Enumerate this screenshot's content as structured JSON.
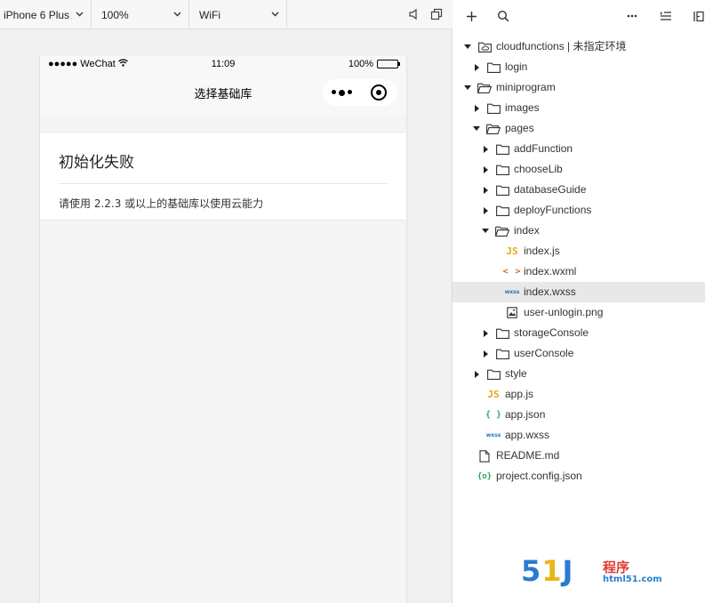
{
  "simulator": {
    "device": "iPhone 6 Plus",
    "zoom": "100%",
    "network": "WiFi"
  },
  "phone": {
    "status": {
      "carrier": "●●●●● WeChat",
      "time": "11:09",
      "battery": "100%",
      "battery_level": 1.0
    },
    "nav_title": "选择基础库",
    "error_title": "初始化失败",
    "error_message": "请使用 2.2.3 或以上的基础库以使用云能力"
  },
  "explorer": {
    "tree": [
      {
        "label": "cloudfunctions | 未指定环境",
        "icon": "cloud-folder-icon",
        "depth": 0,
        "expanded": true
      },
      {
        "label": "login",
        "icon": "folder-icon",
        "depth": 1,
        "expanded": false
      },
      {
        "label": "miniprogram",
        "icon": "folder-open-icon",
        "depth": 0,
        "expanded": true
      },
      {
        "label": "images",
        "icon": "folder-icon",
        "depth": 1,
        "expanded": false
      },
      {
        "label": "pages",
        "icon": "folder-open-icon",
        "depth": 1,
        "expanded": true
      },
      {
        "label": "addFunction",
        "icon": "folder-icon",
        "depth": 2,
        "expanded": false
      },
      {
        "label": "chooseLib",
        "icon": "folder-icon",
        "depth": 2,
        "expanded": false
      },
      {
        "label": "databaseGuide",
        "icon": "folder-icon",
        "depth": 2,
        "expanded": false
      },
      {
        "label": "deployFunctions",
        "icon": "folder-icon",
        "depth": 2,
        "expanded": false
      },
      {
        "label": "index",
        "icon": "folder-open-icon",
        "depth": 2,
        "expanded": true
      },
      {
        "label": "index.js",
        "icon": "js-file-icon",
        "depth": 3,
        "badge": "JS"
      },
      {
        "label": "index.wxml",
        "icon": "wxml-file-icon",
        "depth": 3,
        "badge": "< >"
      },
      {
        "label": "index.wxss",
        "icon": "wxss-file-icon",
        "depth": 3,
        "badge": "wxss",
        "selected": true
      },
      {
        "label": "user-unlogin.png",
        "icon": "image-file-icon",
        "depth": 3
      },
      {
        "label": "storageConsole",
        "icon": "folder-icon",
        "depth": 2,
        "expanded": false
      },
      {
        "label": "userConsole",
        "icon": "folder-icon",
        "depth": 2,
        "expanded": false
      },
      {
        "label": "style",
        "icon": "folder-icon",
        "depth": 1,
        "expanded": false
      },
      {
        "label": "app.js",
        "icon": "js-file-icon",
        "depth": 1,
        "badge": "JS"
      },
      {
        "label": "app.json",
        "icon": "json-file-icon",
        "depth": 1,
        "badge": "{ }"
      },
      {
        "label": "app.wxss",
        "icon": "wxss-file-icon",
        "depth": 1,
        "badge": "wxss"
      },
      {
        "label": "README.md",
        "icon": "file-icon",
        "depth": 0
      },
      {
        "label": "project.config.json",
        "icon": "config-file-icon",
        "depth": 0,
        "badge": "{o}"
      }
    ]
  },
  "watermark": {
    "digits_1": "5",
    "digits_2": "1",
    "digits_3": "J",
    "cn": "程序",
    "url": "html51.com"
  }
}
